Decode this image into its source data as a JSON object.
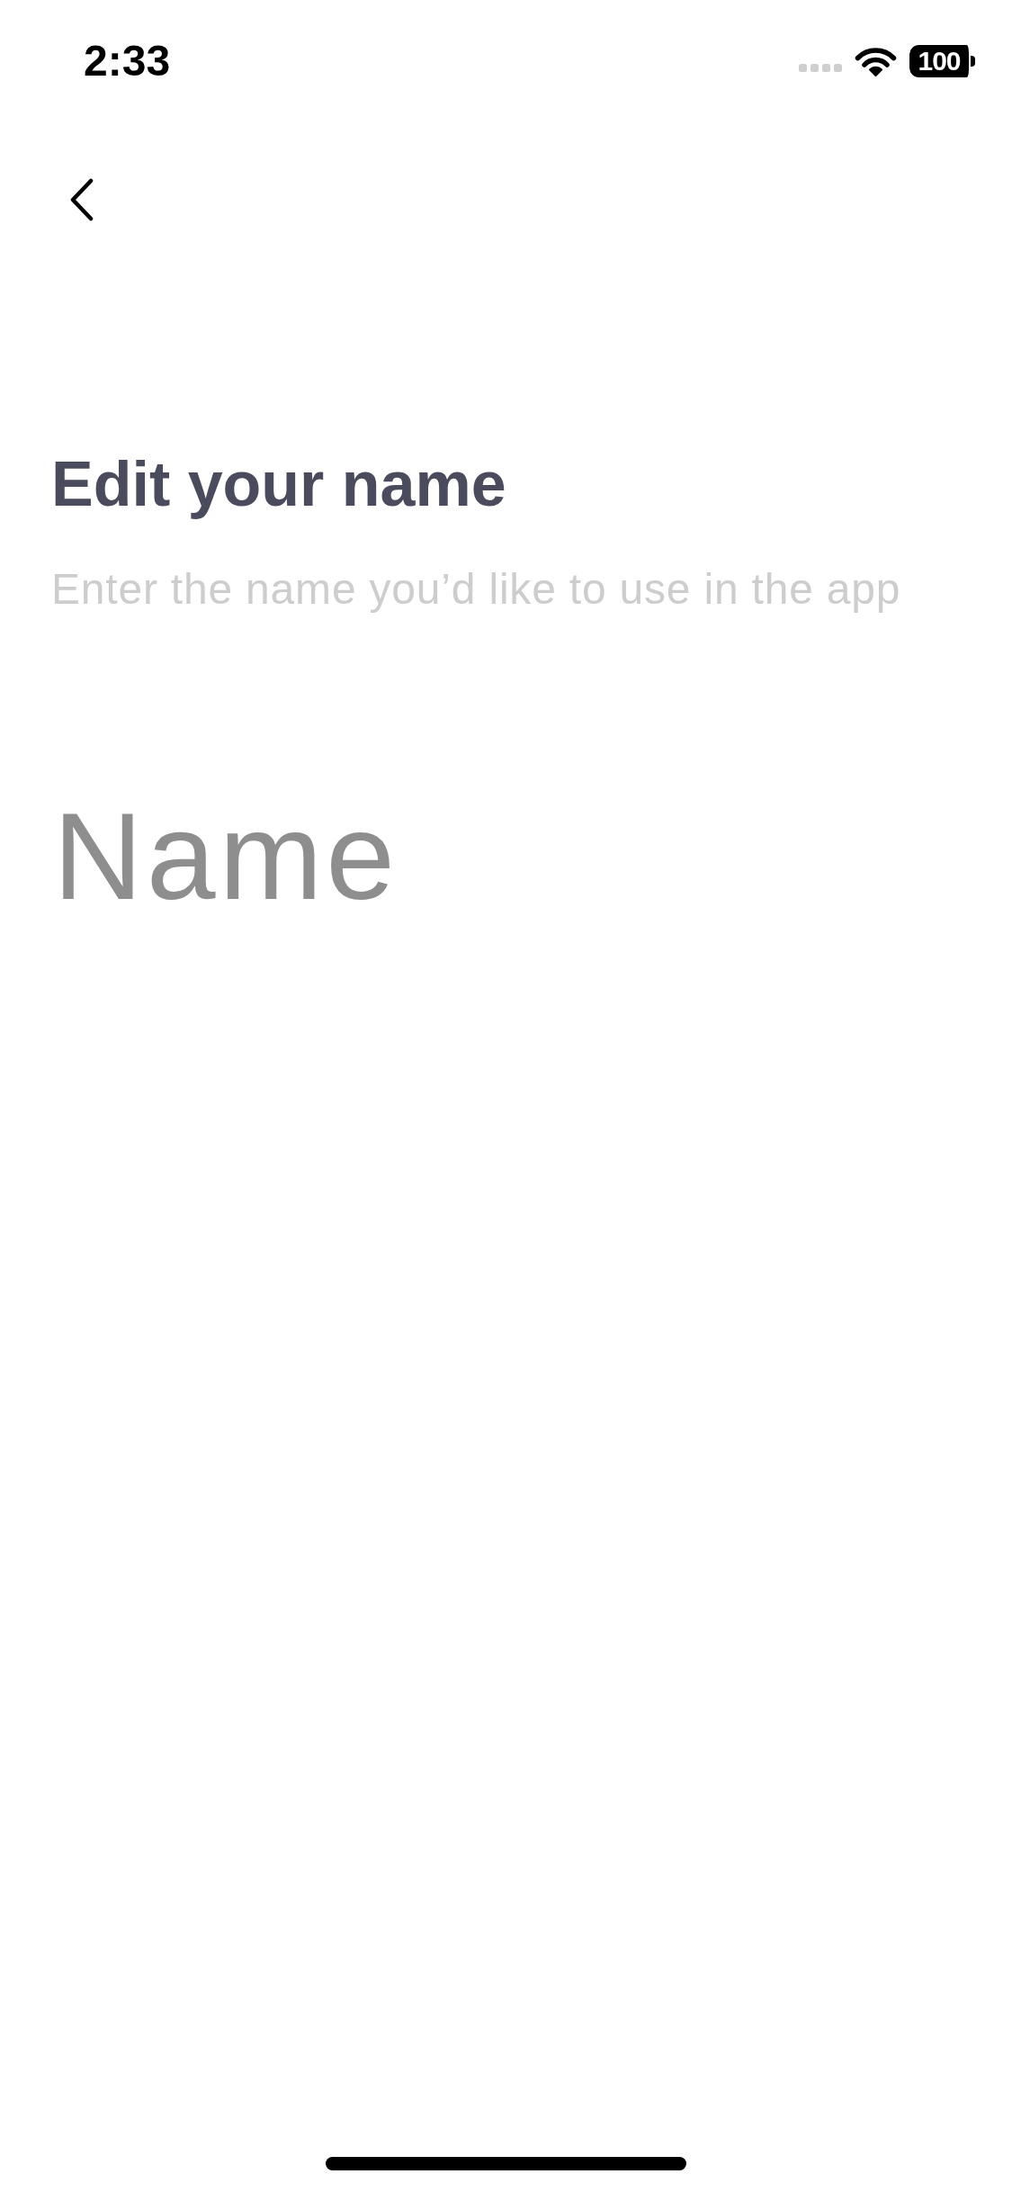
{
  "status_bar": {
    "time": "2:33",
    "battery": "100"
  },
  "header": {
    "title": "Edit your name",
    "subtitle": "Enter the name you’d like to use in the app"
  },
  "name_field": {
    "placeholder": "Name"
  }
}
